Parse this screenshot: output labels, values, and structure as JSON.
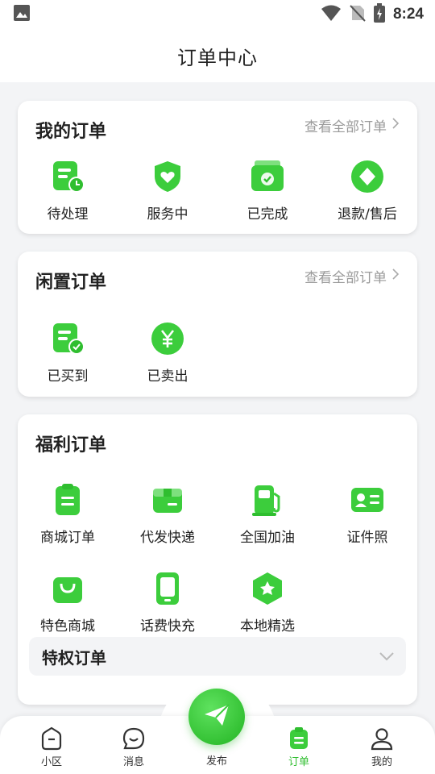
{
  "status_bar": {
    "time": "8:24"
  },
  "header": {
    "title": "订单中心"
  },
  "my_orders": {
    "title": "我的订单",
    "more": "查看全部订单",
    "items": [
      {
        "label": "待处理",
        "icon": "pending-doc-icon"
      },
      {
        "label": "服务中",
        "icon": "heart-shield-icon"
      },
      {
        "label": "已完成",
        "icon": "completed-box-icon"
      },
      {
        "label": "退款/售后",
        "icon": "refund-diamond-icon"
      }
    ]
  },
  "idle_orders": {
    "title": "闲置订单",
    "more": "查看全部订单",
    "items": [
      {
        "label": "已买到",
        "icon": "bought-doc-icon"
      },
      {
        "label": "已卖出",
        "icon": "yen-coin-icon"
      }
    ]
  },
  "welfare_orders": {
    "title": "福利订单",
    "items": [
      {
        "label": "商城订单",
        "icon": "clipboard-icon"
      },
      {
        "label": "代发快递",
        "icon": "package-icon"
      },
      {
        "label": "全国加油",
        "icon": "fuel-pump-icon"
      },
      {
        "label": "证件照",
        "icon": "id-card-icon"
      },
      {
        "label": "特色商城",
        "icon": "shopping-bag-icon"
      },
      {
        "label": "话费快充",
        "icon": "phone-icon"
      },
      {
        "label": "本地精选",
        "icon": "star-badge-icon"
      }
    ],
    "privilege": {
      "label": "特权订单"
    }
  },
  "tabbar": {
    "tabs": [
      {
        "label": "小区",
        "icon": "home-icon"
      },
      {
        "label": "消息",
        "icon": "message-icon"
      },
      {
        "label": "发布",
        "icon": "paper-plane-icon"
      },
      {
        "label": "订单",
        "icon": "order-icon",
        "active": true
      },
      {
        "label": "我的",
        "icon": "user-icon"
      }
    ]
  },
  "colors": {
    "accent": "#2fbe2f",
    "icon_green": "#3ccd3c",
    "background": "#f3f4f6"
  }
}
